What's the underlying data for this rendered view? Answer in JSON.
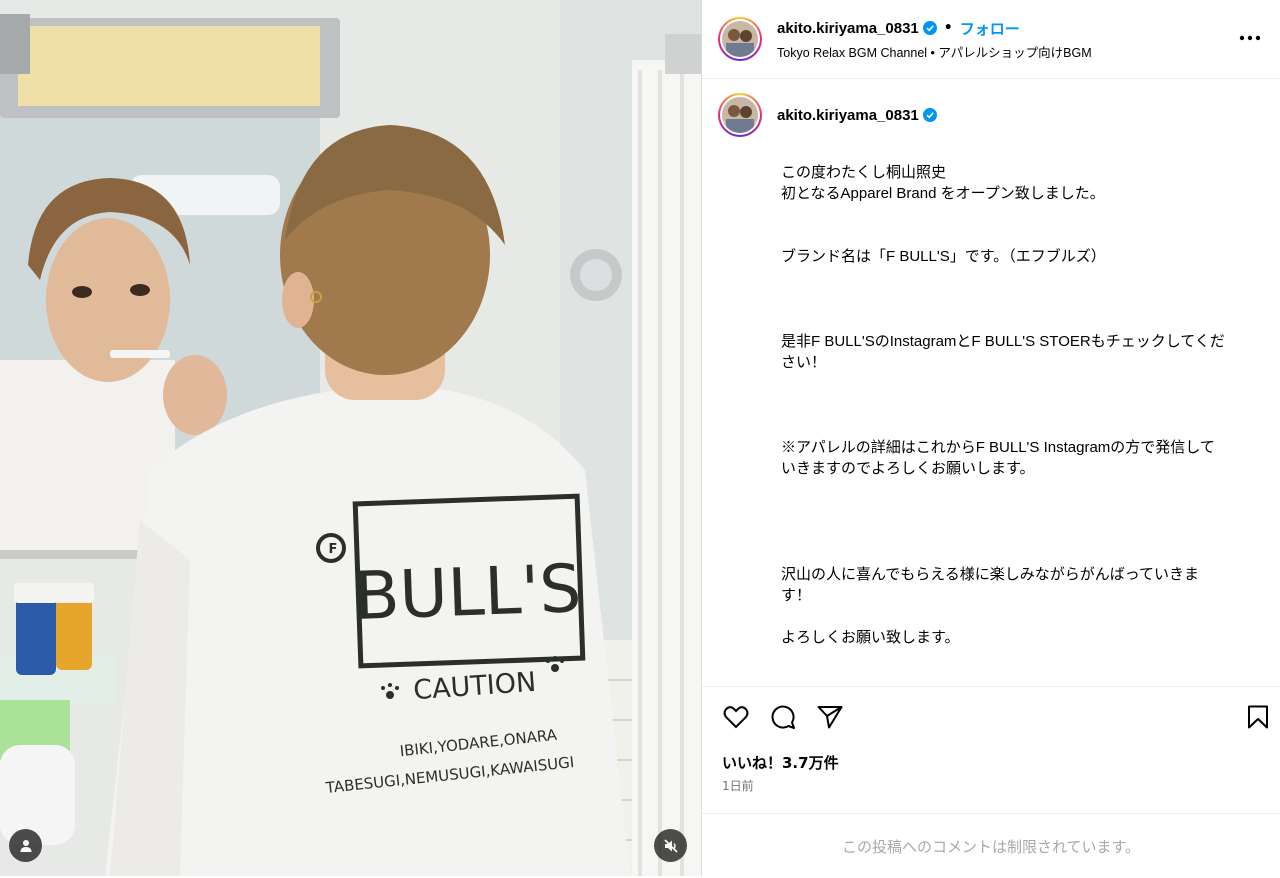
{
  "post": {
    "username": "akito.kiriyama_0831",
    "follow_label": "フォロー",
    "dot": "•",
    "subtitle": "Tokyo Relax BGM Channel • アパレルショップ向けBGM",
    "caption_lines": [
      "この度わたくし桐山照史\n初となるApparel Brand をオープン致しました。",
      "ブランド名は「F BULL'S」です。（エフブルズ）",
      "是非F BULL'SのInstagramとF BULL'S STOERもチェックしてくだ\nさい！",
      "※アパレルの詳細はこれからF BULL'S Instagramの方で発信して\nいきますのでよろしくお願いします。",
      "沢山の人に喜んでもらえる様に楽しみながらがんばっていきま\nす！",
      "よろしくお願い致します。"
    ],
    "likes": "いいね！3.7万件",
    "time_ago": "1日前",
    "comments_disabled": "この投稿へのコメントは制限されています。"
  },
  "shirt_print": {
    "brand": "BULL'S",
    "caution": "CAUTION",
    "line1": "IBIKI,YODARE,ONARA",
    "line2": "TABESUGI,NEMUSUGI,KAWAISUGI"
  },
  "icons": {
    "verified": "verified-badge-icon",
    "more": "more-options-icon",
    "like": "heart-icon",
    "comment": "comment-icon",
    "share": "send-icon",
    "save": "bookmark-icon",
    "tag": "user-tag-icon",
    "mute": "muted-speaker-icon"
  },
  "colors": {
    "link_blue": "#0095f6",
    "verified_blue": "#0095f6",
    "muted_text": "#737373",
    "disabled_text": "#a8a8a8"
  }
}
